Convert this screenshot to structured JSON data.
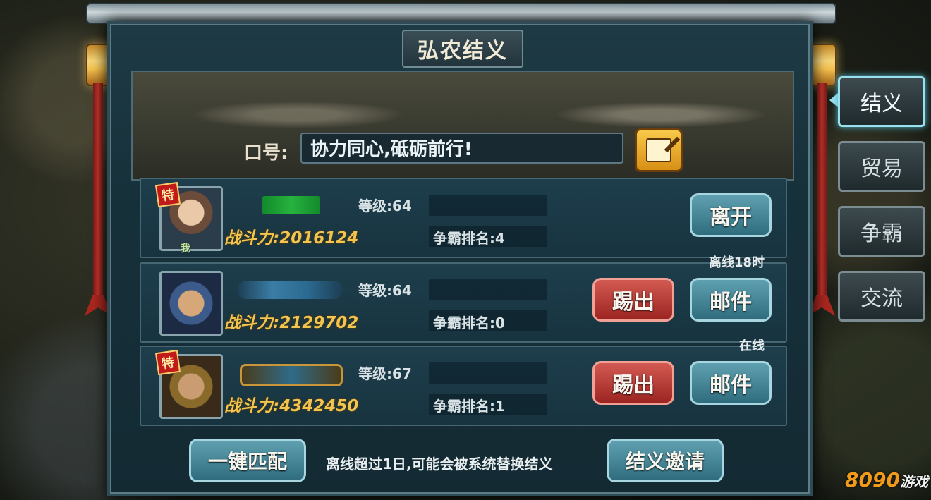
{
  "panel": {
    "title": "弘农结义"
  },
  "slogan": {
    "label": "口号:",
    "text": "协力同心,砥砺前行!"
  },
  "members": [
    {
      "level": "等级:64",
      "power": "战斗力:2016124",
      "rank": "争霸排名:4",
      "me_tag": "我",
      "special_tag": "特",
      "status": "",
      "primary_button": "离开"
    },
    {
      "level": "等级:64",
      "power": "战斗力:2129702",
      "rank": "争霸排名:0",
      "status": "离线18时",
      "kick_button": "踢出",
      "mail_button": "邮件"
    },
    {
      "level": "等级:67",
      "power": "战斗力:4342450",
      "rank": "争霸排名:1",
      "special_tag": "特",
      "status": "在线",
      "kick_button": "踢出",
      "mail_button": "邮件"
    }
  ],
  "footer": {
    "match_button": "一键匹配",
    "notice": "离线超过1日,可能会被系统替换结义",
    "invite_button": "结义邀请"
  },
  "side_tabs": [
    "结义",
    "贸易",
    "争霸",
    "交流"
  ],
  "watermark": {
    "number": "8090",
    "text": "游戏"
  }
}
